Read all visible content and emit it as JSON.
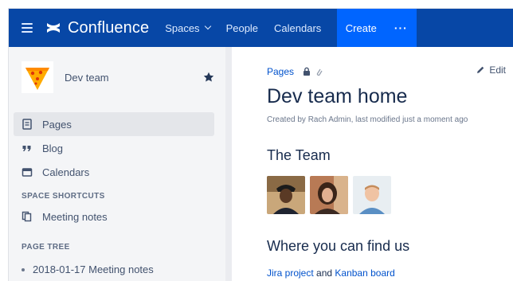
{
  "topnav": {
    "brand": "Confluence",
    "spaces": "Spaces",
    "people": "People",
    "calendars": "Calendars",
    "create": "Create",
    "more": "···"
  },
  "sidebar": {
    "space_name": "Dev team",
    "items": [
      {
        "label": "Pages",
        "icon": "pages-icon"
      },
      {
        "label": "Blog",
        "icon": "blog-quote-icon"
      },
      {
        "label": "Calendars",
        "icon": "calendar-icon"
      }
    ],
    "shortcuts_title": "SPACE SHORTCUTS",
    "shortcuts": [
      {
        "label": "Meeting notes",
        "icon": "copy-page-icon"
      }
    ],
    "tree_title": "PAGE TREE",
    "tree": [
      {
        "label": "2018-01-17 Meeting notes"
      }
    ]
  },
  "main": {
    "breadcrumb": "Pages",
    "edit": "Edit",
    "title": "Dev team home",
    "byline": "Created by Rach Admin, last modified just a moment ago",
    "team_heading": "The Team",
    "find_heading": "Where you can find us",
    "links": {
      "jira": "Jira project",
      "and": " and ",
      "kanban": "Kanban board"
    }
  },
  "colors": {
    "nav_bg": "#0747a6",
    "create_bg": "#0065ff",
    "link": "#0052cc",
    "sidebar_bg": "#f4f5f7"
  }
}
